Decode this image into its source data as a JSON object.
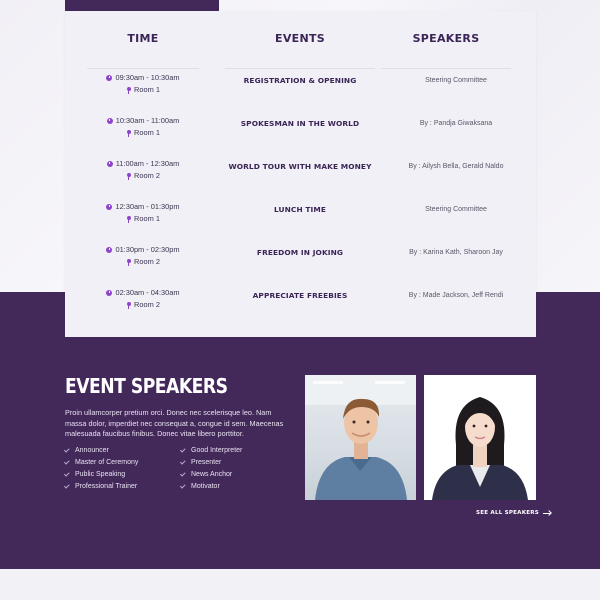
{
  "schedule": {
    "headers": {
      "time": "TIME",
      "events": "EVENTS",
      "speakers": "SPEAKERS"
    },
    "rows": [
      {
        "time": "09:30am - 10:30am",
        "room": "Room 1",
        "event": "REGISTRATION & OPENING",
        "speaker": "Steering Committee"
      },
      {
        "time": "10:30am - 11:00am",
        "room": "Room 1",
        "event": "SPOKESMAN IN THE WORLD",
        "speaker": "By : Pandja Giwaksana"
      },
      {
        "time": "11:00am - 12:30am",
        "room": "Room 2",
        "event": "WORLD TOUR WITH MAKE MONEY",
        "speaker": "By : Ailysh Bella, Gerald Naldo"
      },
      {
        "time": "12:30am - 01:30pm",
        "room": "Room 1",
        "event": "LUNCH TIME",
        "speaker": "Steering Committee"
      },
      {
        "time": "01:30pm - 02:30pm",
        "room": "Room 2",
        "event": "FREEDOM IN JOKING",
        "speaker": "By : Karina Kath, Sharoon Jay"
      },
      {
        "time": "02:30am - 04:30am",
        "room": "Room 2",
        "event": "APPRECIATE FREEBIES",
        "speaker": "By : Made Jackson, Jeff Rendi"
      }
    ]
  },
  "speakers_section": {
    "title": "EVENT SPEAKERS",
    "description": "Proin ullamcorper pretium orci. Donec nec scelerisque leo. Nam massa dolor, imperdiet nec consequat a, congue id sem. Maecenas malesuada faucibus finibus. Donec vitae libero porttitor.",
    "roles": [
      "Announcer",
      "Good Interpreter",
      "Master of Ceremony",
      "Presenter",
      "Public Speaking",
      "News Anchor",
      "Professional Trainer",
      "Motivator"
    ],
    "see_all": "SEE ALL SPEAKERS"
  },
  "colors": {
    "brand_purple": "#43285a",
    "accent_violet": "#8e44c9",
    "card_bg": "#f1f0f7"
  }
}
